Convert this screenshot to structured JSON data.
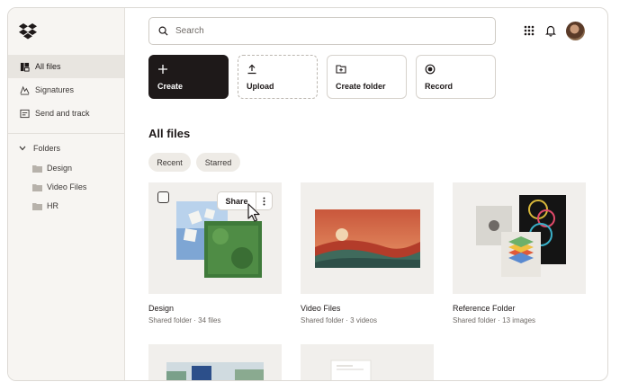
{
  "sidebar": {
    "nav": [
      {
        "label": "All files",
        "icon": "files-icon",
        "active": true
      },
      {
        "label": "Signatures",
        "icon": "signature-icon",
        "active": false
      },
      {
        "label": "Send and track",
        "icon": "send-track-icon",
        "active": false
      }
    ],
    "folders_label": "Folders",
    "folders": [
      {
        "label": "Design"
      },
      {
        "label": "Video Files"
      },
      {
        "label": "HR"
      }
    ]
  },
  "header": {
    "search_placeholder": "Search"
  },
  "actions": [
    {
      "label": "Create",
      "icon": "plus-icon"
    },
    {
      "label": "Upload",
      "icon": "upload-icon"
    },
    {
      "label": "Create folder",
      "icon": "create-folder-icon"
    },
    {
      "label": "Record",
      "icon": "record-icon"
    }
  ],
  "main": {
    "title": "All files",
    "filters": [
      "Recent",
      "Starred"
    ],
    "cards": [
      {
        "name": "Design",
        "meta": "Shared folder · 34 files"
      },
      {
        "name": "Video Files",
        "meta": "Shared folder · 3 videos"
      },
      {
        "name": "Reference Folder",
        "meta": "Shared folder · 13 images"
      }
    ],
    "share_label": "Share"
  },
  "colors": {
    "accent_dark": "#1e1919",
    "sidebar_bg": "#f7f5f2",
    "logo_blue": "#1e1919"
  }
}
